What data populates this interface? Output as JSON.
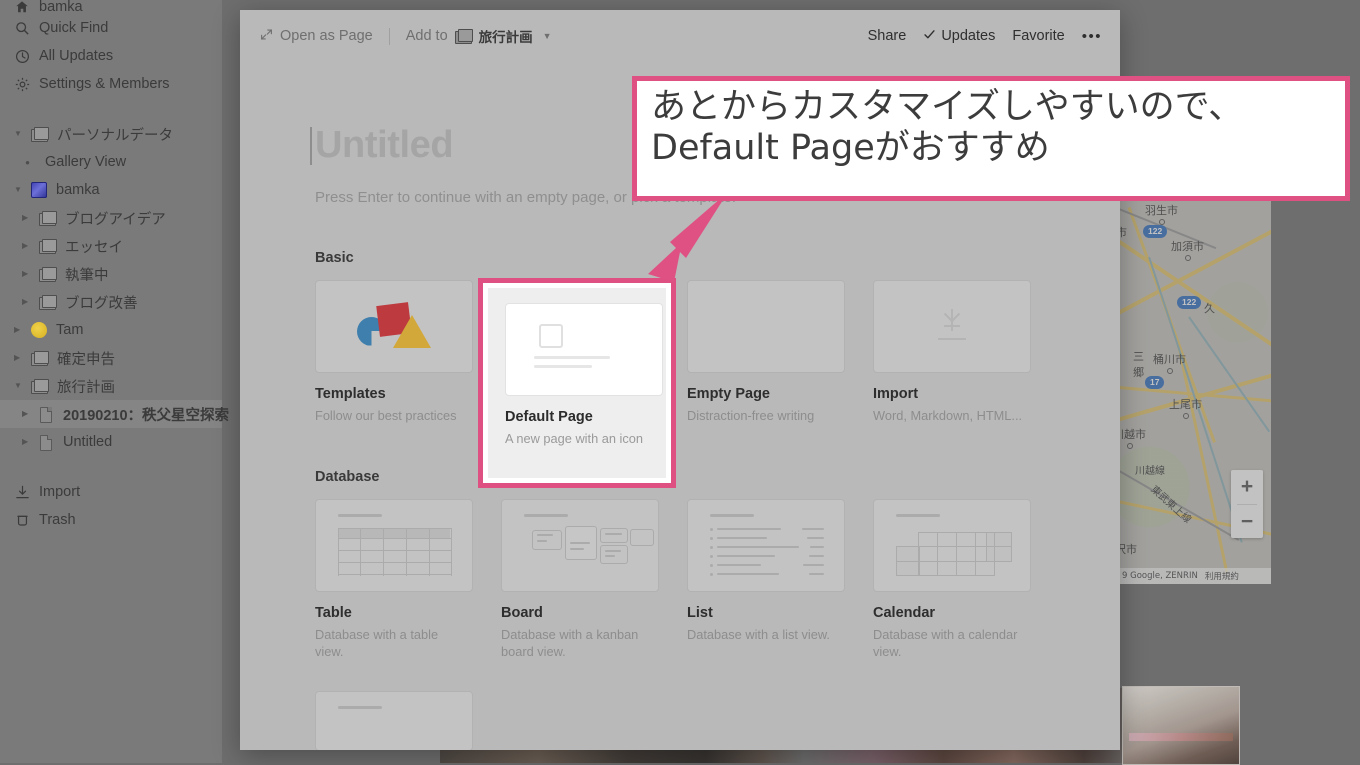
{
  "sidebar": {
    "workspace_name_clipped": "bamka",
    "top_items": [
      {
        "label": "Quick Find",
        "icon": "search-icon"
      },
      {
        "label": "All Updates",
        "icon": "clock-icon"
      },
      {
        "label": "Settings & Members",
        "icon": "gear-icon"
      }
    ],
    "tree": [
      {
        "label": "パーソナルデータ",
        "icon": "folder-icon",
        "caret": "down",
        "indent": 0
      },
      {
        "label": "Gallery View",
        "icon": "bullet",
        "caret": "none",
        "indent": 1
      },
      {
        "label": "bamka",
        "icon": "bamka-avatar-icon",
        "caret": "down",
        "indent": 0
      },
      {
        "label": "ブログアイデア",
        "icon": "folder-icon",
        "caret": "right",
        "indent": 1
      },
      {
        "label": "エッセイ",
        "icon": "folder-icon",
        "caret": "right",
        "indent": 1
      },
      {
        "label": "執筆中",
        "icon": "folder-icon",
        "caret": "right",
        "indent": 1
      },
      {
        "label": "ブログ改善",
        "icon": "folder-icon",
        "caret": "right",
        "indent": 1
      },
      {
        "label": "Tam",
        "icon": "yellow-circle-icon",
        "caret": "right",
        "indent": 0
      },
      {
        "label": "確定申告",
        "icon": "folder-icon",
        "caret": "right",
        "indent": 0
      },
      {
        "label": "旅行計画",
        "icon": "folder-icon",
        "caret": "down",
        "indent": 0
      },
      {
        "label": "20190210：秩父星空探索",
        "icon": "doc-icon",
        "caret": "right",
        "indent": 1,
        "selected": true
      },
      {
        "label": "Untitled",
        "icon": "doc-icon",
        "caret": "right",
        "indent": 1
      }
    ],
    "bottom_items": [
      {
        "label": "Import",
        "icon": "import-icon"
      },
      {
        "label": "Trash",
        "icon": "trash-icon"
      }
    ]
  },
  "toolbar": {
    "open_as_page": "Open as Page",
    "add_to_label": "Add to",
    "destination": "旅行計画",
    "share": "Share",
    "updates": "Updates",
    "favorite": "Favorite",
    "more": "•••"
  },
  "page": {
    "title_placeholder": "Untitled",
    "hint": "Press Enter to continue with an empty page, or pick a template."
  },
  "sections": [
    {
      "title": "Basic",
      "cards": [
        {
          "name": "Templates",
          "desc": "Follow our best practices",
          "art": "shapes"
        },
        {
          "name": "Default Page",
          "desc": "A new page with an icon",
          "art": "default-page",
          "highlighted": true
        },
        {
          "name": "Empty Page",
          "desc": "Distraction-free writing",
          "art": "blank"
        },
        {
          "name": "Import",
          "desc": "Word, Markdown, HTML...",
          "art": "download"
        }
      ]
    },
    {
      "title": "Database",
      "cards": [
        {
          "name": "Table",
          "desc": "Database with a table view.",
          "art": "table"
        },
        {
          "name": "Board",
          "desc": "Database with a kanban board view.",
          "art": "board"
        },
        {
          "name": "List",
          "desc": "Database with a list view.",
          "art": "list"
        },
        {
          "name": "Calendar",
          "desc": "Database with a calendar view.",
          "art": "calendar"
        }
      ]
    }
  ],
  "annotation": {
    "line1": "あとからカスタマイズしやすいので、",
    "line2": "Default Pageがおすすめ",
    "accent_color": "#df5183"
  },
  "map": {
    "cities": [
      "羽生市",
      "加須市",
      "桶川市",
      "上尾市",
      "川越市",
      "三郷",
      "久",
      "沢市"
    ],
    "rail_labels": [
      "川越線",
      "東武東上線"
    ],
    "route_shields": [
      "122",
      "122",
      "17"
    ],
    "zoom_in": "+",
    "zoom_out": "−",
    "attribution": "9 Google, ZENRIN",
    "terms": "利用規約"
  }
}
